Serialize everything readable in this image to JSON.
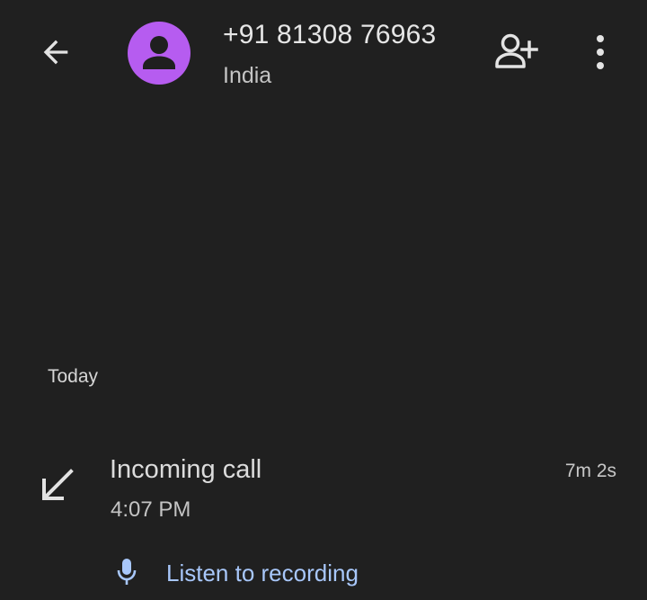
{
  "header": {
    "back_icon": "arrow-back-icon",
    "avatar_icon": "person-icon",
    "phone_number": "+91 81308 76963",
    "country": "India",
    "add_contact_icon": "person-add-icon",
    "more_icon": "more-vert-icon"
  },
  "history": {
    "section_label": "Today",
    "calls": [
      {
        "direction_icon": "call-received-icon",
        "type": "Incoming call",
        "time": "4:07 PM",
        "duration": "7m 2s",
        "recording": {
          "icon": "mic-icon",
          "label": "Listen to recording"
        }
      }
    ]
  },
  "colors": {
    "background": "#202020",
    "avatar": "#b65cf0",
    "link": "#a8c7fa",
    "icon": "#e3e3e3"
  }
}
